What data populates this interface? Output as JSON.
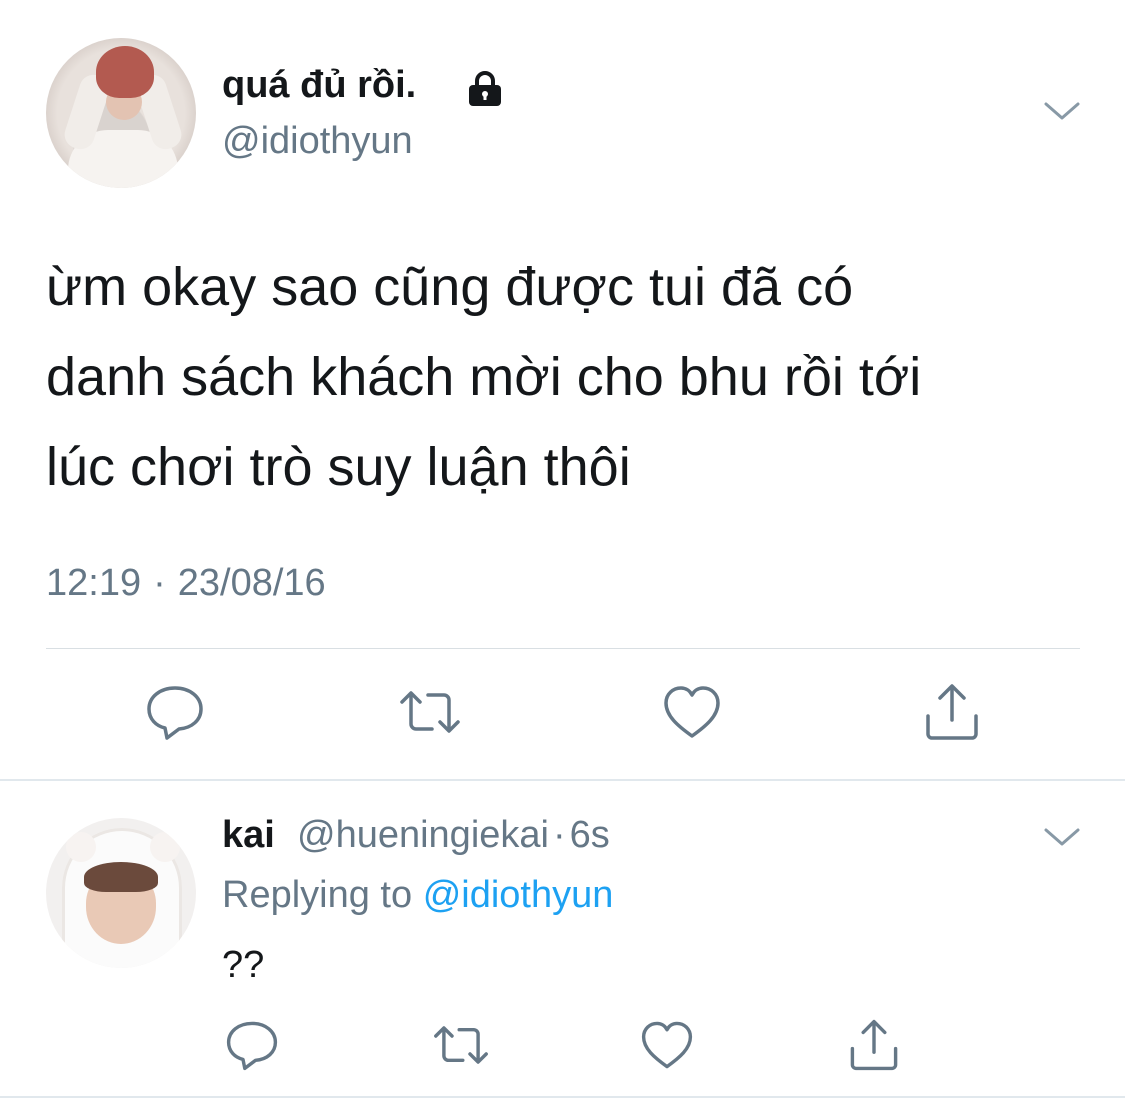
{
  "tweet": {
    "display_name": "quá đủ rồi.",
    "handle": "@idiothyun",
    "locked_icon": "lock-icon",
    "text_lines": [
      "ừm okay sao cũng được tui đã có",
      "danh sách khách mời cho bhu rồi tới",
      "lúc chơi trò suy luận thôi"
    ],
    "time": "12:19",
    "separator": "·",
    "date": "23/08/16",
    "actions": [
      "reply-icon",
      "retweet-icon",
      "like-icon",
      "share-icon"
    ]
  },
  "reply": {
    "name": "kai",
    "handle": "@hueningiekai",
    "separator": "·",
    "age": "6s",
    "replying_prefix": "Replying to",
    "replying_to": "@idiothyun",
    "text": "??",
    "actions": [
      "reply-icon",
      "retweet-icon",
      "like-icon",
      "share-icon"
    ]
  },
  "colors": {
    "text": "#14171a",
    "secondary": "#657786",
    "link": "#1da1f2",
    "divider": "#e1e8ed"
  }
}
